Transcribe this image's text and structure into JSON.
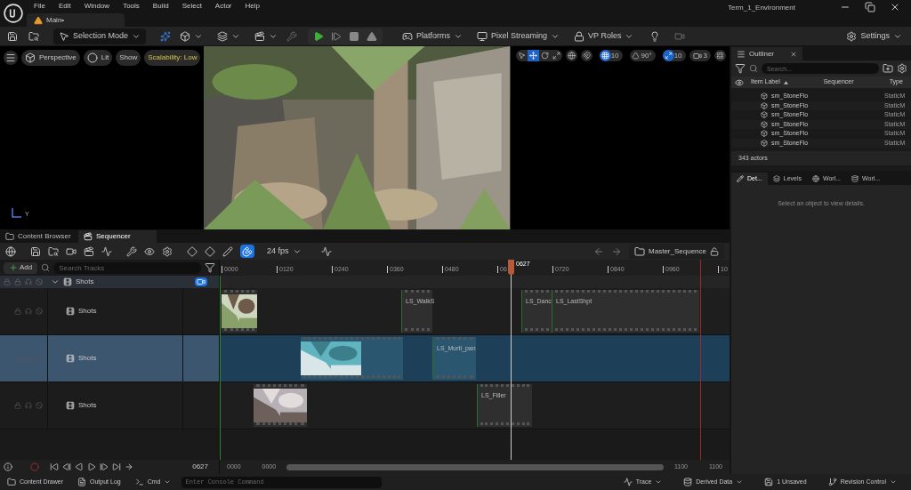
{
  "menu": [
    "File",
    "Edit",
    "Window",
    "Tools",
    "Build",
    "Select",
    "Actor",
    "Help"
  ],
  "document_tab": {
    "label": "Main•"
  },
  "project_title": "Term_1_Environment",
  "toolbar": {
    "mode": "Selection Mode",
    "platforms": "Platforms",
    "pixel_streaming": "Pixel Streaming",
    "vp_roles": "VP Roles",
    "settings": "Settings"
  },
  "viewport": {
    "view": "Perspective",
    "lighting": "Lit",
    "show": "Show",
    "scalability": "Scalability: Low",
    "axis_label": "Y",
    "transform_tools": [
      {
        "kind": "select",
        "selected": false
      },
      {
        "kind": "translate",
        "selected": true
      },
      {
        "kind": "rotate",
        "selected": false
      },
      {
        "kind": "scale",
        "selected": false
      }
    ],
    "grid_snap": {
      "on": true,
      "value": "10"
    },
    "angle_snap": {
      "on": false,
      "value": "90°"
    },
    "scale_snap": {
      "on": true,
      "value": "10"
    },
    "camera_speed": "3"
  },
  "bottom_tabs": [
    {
      "label": "Content Browser",
      "selected": false
    },
    {
      "label": "Sequencer",
      "selected": true
    }
  ],
  "sequencer": {
    "snap_on": true,
    "fps": "24 fps",
    "sequence": "Master_Sequence",
    "add": "Add",
    "search_placeholder": "Search Tracks",
    "current_frame": "0627",
    "ruler_ticks": [
      "0000",
      "0120",
      "0240",
      "0360",
      "0480",
      "06",
      "0720",
      "0840",
      "0960",
      "10"
    ],
    "tracks": [
      {
        "label": "Shots",
        "expanded": true,
        "children": [
          {
            "label": "Shots",
            "selected": false,
            "clips": [
              {
                "kind": "thumbnail"
              },
              {
                "kind": "named",
                "label": "LS_WalkS"
              },
              {
                "kind": "named",
                "label": "LS_Danc"
              },
              {
                "kind": "named",
                "label": "LS_LastShpt"
              }
            ]
          },
          {
            "label": "Shots",
            "selected": true,
            "clips": [
              {
                "kind": "thumbnail"
              },
              {
                "kind": "named",
                "label": "LS_Murti_pan"
              }
            ]
          },
          {
            "label": "Shots",
            "selected": false,
            "clips": [
              {
                "kind": "thumbnail"
              },
              {
                "kind": "named",
                "label": "LS_Filler"
              }
            ]
          }
        ]
      }
    ],
    "transport_frame": "0627",
    "range": [
      "0000",
      "0000",
      "1100",
      "1100"
    ]
  },
  "outliner": {
    "title": "Outliner",
    "search_placeholder": "Search...",
    "columns": [
      "Item Label",
      "Sequencer",
      "Type"
    ],
    "rows": [
      {
        "label": "sm_StoneFlo",
        "type": "StaticM"
      },
      {
        "label": "sm_StoneFlo",
        "type": "StaticM"
      },
      {
        "label": "sm_StoneFlo",
        "type": "StaticM"
      },
      {
        "label": "sm_StoneFlo",
        "type": "StaticM"
      },
      {
        "label": "sm_StoneFlo",
        "type": "StaticM"
      },
      {
        "label": "sm_StoneFlo",
        "type": "StaticM"
      }
    ],
    "count": "343 actors"
  },
  "details_tabs": [
    {
      "label": "Det...",
      "selected": true
    },
    {
      "label": "Levels",
      "selected": false
    },
    {
      "label": "Worl...",
      "selected": false
    },
    {
      "label": "Worl...",
      "selected": false
    }
  ],
  "details_empty": "Select an object to view details.",
  "status_bar": {
    "left": [
      "Content Drawer",
      "Output Log",
      "Cmd"
    ],
    "console_placeholder": "Enter Console Command",
    "right": [
      "Trace",
      "Derived Data",
      "1 Unsaved",
      "Revision Control"
    ]
  }
}
